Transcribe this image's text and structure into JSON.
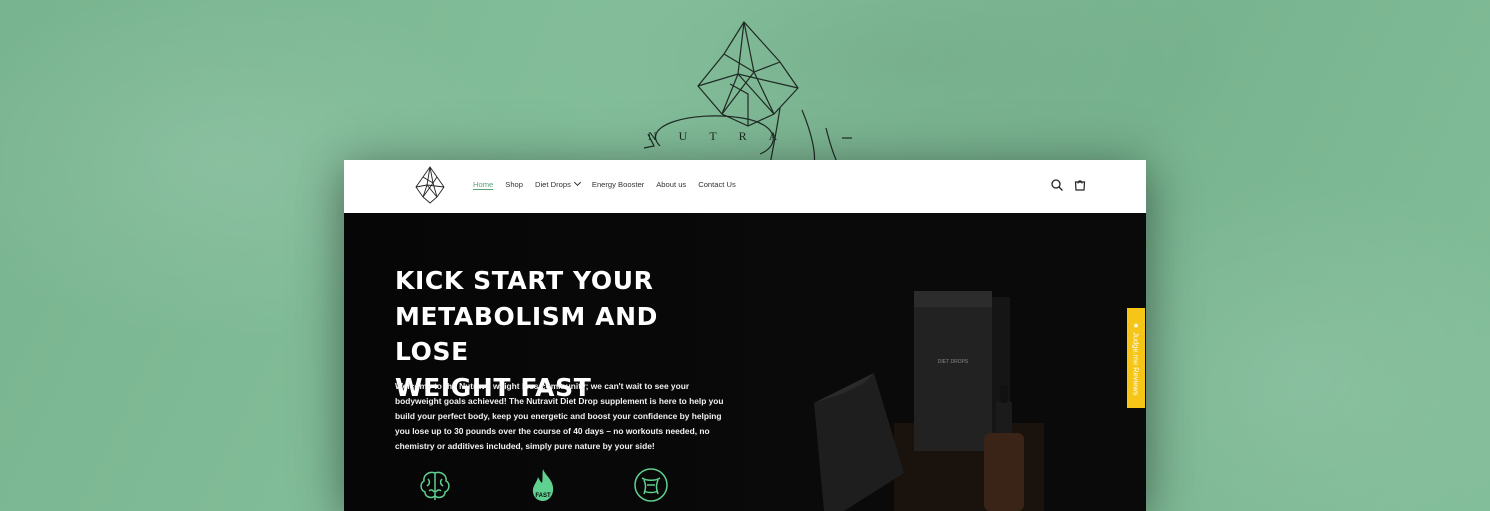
{
  "brand": {
    "word": "NUTRA"
  },
  "nav": {
    "links": [
      "Home",
      "Shop",
      "Diet Drops",
      "Energy Booster",
      "About us",
      "Contact Us"
    ],
    "active": "Home"
  },
  "hero": {
    "title_lines": [
      "KICK START YOUR",
      "METABOLISM AND LOSE",
      "WEIGHT FAST"
    ],
    "text": "Welcome to the Nutravit weight loss community; we can't wait to see your bodyweight goals achieved! The Nutravit Diet Drop supplement is here to help you build your perfect body, keep you energetic and boost your confidence by helping you lose up to 30 pounds over the course of 40 days – no workouts needed, no chemistry or additives included, simply pure nature by your side!",
    "features": [
      {
        "icon": "brain-icon"
      },
      {
        "icon": "fast-flame-icon",
        "label": "FAST"
      },
      {
        "icon": "body-shape-icon"
      }
    ]
  },
  "product": {
    "box_label": "DIET DROPS"
  },
  "reviews_tab": {
    "label": "★ Judge.me Reviews"
  },
  "colors": {
    "background": "#7dbb95",
    "accent": "#58a37a",
    "hero_bg": "#080808",
    "review_tab": "#f5c518"
  }
}
